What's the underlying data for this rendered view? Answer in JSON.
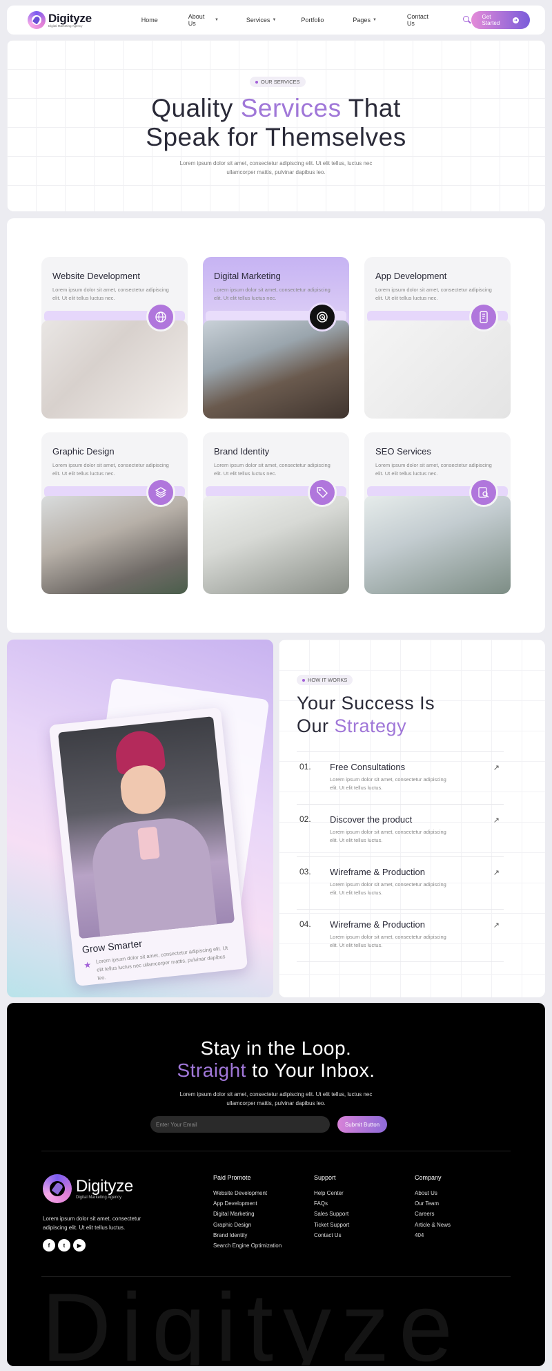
{
  "nav": {
    "logo_title": "Digityze",
    "logo_sub": "Digital Marketing Agency",
    "links": [
      {
        "label": "Home",
        "dropdown": false
      },
      {
        "label": "About Us",
        "dropdown": true
      },
      {
        "label": "Services",
        "dropdown": true
      },
      {
        "label": "Portfolio",
        "dropdown": false
      },
      {
        "label": "Pages",
        "dropdown": true
      },
      {
        "label": "Contact Us",
        "dropdown": false
      }
    ],
    "cta": "Get Started"
  },
  "hero": {
    "pill": "OUR SERVICES",
    "title_line1_a": "Quality ",
    "title_line1_accent": "Services",
    "title_line1_b": " That",
    "title_line2": "Speak for Themselves",
    "desc": "Lorem ipsum dolor sit amet, consectetur adipiscing elit. Ut elit tellus, luctus nec ullamcorper mattis, pulvinar dapibus leo."
  },
  "services": [
    {
      "title": "Website Development",
      "desc": "Lorem ipsum dolor sit amet, consectetur adipiscing elit. Ut elit tellus luctus nec.",
      "icon": "globe-icon",
      "active": false
    },
    {
      "title": "Digital Marketing",
      "desc": "Lorem ipsum dolor sit amet, consectetur adipiscing elit. Ut elit tellus luctus nec.",
      "icon": "target-icon",
      "active": true
    },
    {
      "title": "App Development",
      "desc": "Lorem ipsum dolor sit amet, consectetur adipiscing elit. Ut elit tellus luctus nec.",
      "icon": "mobile-app-icon",
      "active": false
    },
    {
      "title": "Graphic Design",
      "desc": "Lorem ipsum dolor sit amet, consectetur adipiscing elit. Ut elit tellus luctus nec.",
      "icon": "layers-icon",
      "active": false
    },
    {
      "title": "Brand Identity",
      "desc": "Lorem ipsum dolor sit amet, consectetur adipiscing elit. Ut elit tellus luctus nec.",
      "icon": "tag-icon",
      "active": false
    },
    {
      "title": "SEO Services",
      "desc": "Lorem ipsum dolor sit amet, consectetur adipiscing elit. Ut elit tellus luctus nec.",
      "icon": "seo-search-icon",
      "active": false
    }
  ],
  "how": {
    "pill": "HOW IT WORKS",
    "title_line1": "Your Success Is",
    "title_line2_a": "Our ",
    "title_line2_accent": "Strategy",
    "photo_caption_title": "Grow Smarter",
    "photo_caption_desc": "Lorem ipsum dolor sit amet, consectetur adipiscing elit. Ut elit tellus luctus nec ullamcorper mattis, pulvinar dapibus leo.",
    "steps": [
      {
        "num": "01.",
        "title": "Free Consultations",
        "desc": "Lorem ipsum dolor sit amet, consectetur adipiscing elit. Ut elit tellus luctus."
      },
      {
        "num": "02.",
        "title": "Discover the product",
        "desc": "Lorem ipsum dolor sit amet, consectetur adipiscing elit. Ut elit tellus luctus."
      },
      {
        "num": "03.",
        "title": "Wireframe & Production",
        "desc": "Lorem ipsum dolor sit amet, consectetur adipiscing elit. Ut elit tellus luctus."
      },
      {
        "num": "04.",
        "title": "Wireframe & Production",
        "desc": "Lorem ipsum dolor sit amet, consectetur adipiscing elit. Ut elit tellus luctus."
      }
    ]
  },
  "footer": {
    "heading_line1": "Stay in the Loop.",
    "heading_line2_accent": "Straight",
    "heading_line2_b": " to Your Inbox.",
    "desc": "Lorem ipsum dolor sit amet, consectetur adipiscing elit. Ut elit tellus, luctus nec ullamcorper mattis, pulvinar dapibus leo.",
    "email_placeholder": "Enter Your Email",
    "submit": "Submit Button",
    "logo_title": "Digityze",
    "logo_sub": "Digital Marketing Agency",
    "about": "Lorem ipsum dolor sit amet, consectetur adipiscing elit. Ut elit tellus luctus.",
    "socials": [
      {
        "icon": "facebook-icon",
        "glyph": "f"
      },
      {
        "icon": "twitter-icon",
        "glyph": "t"
      },
      {
        "icon": "youtube-icon",
        "glyph": "▶"
      }
    ],
    "columns": [
      {
        "title": "Paid Promote",
        "items": [
          "Website Development",
          "App Development",
          "Digital Marketing",
          "Graphic Design",
          "Brand Identity",
          "Search Engine Optimization"
        ]
      },
      {
        "title": "Support",
        "items": [
          "Help Center",
          "FAQs",
          "Sales Support",
          "Ticket Support",
          "Contact Us"
        ]
      },
      {
        "title": "Company",
        "items": [
          "About Us",
          "Our Team",
          "Careers",
          "Article & News",
          "404"
        ]
      }
    ],
    "watermark": "Digityze"
  },
  "colors": {
    "accent": "#a077d8",
    "brand_gradient_start": "#e48bd8",
    "brand_gradient_end": "#7a5cd9"
  }
}
